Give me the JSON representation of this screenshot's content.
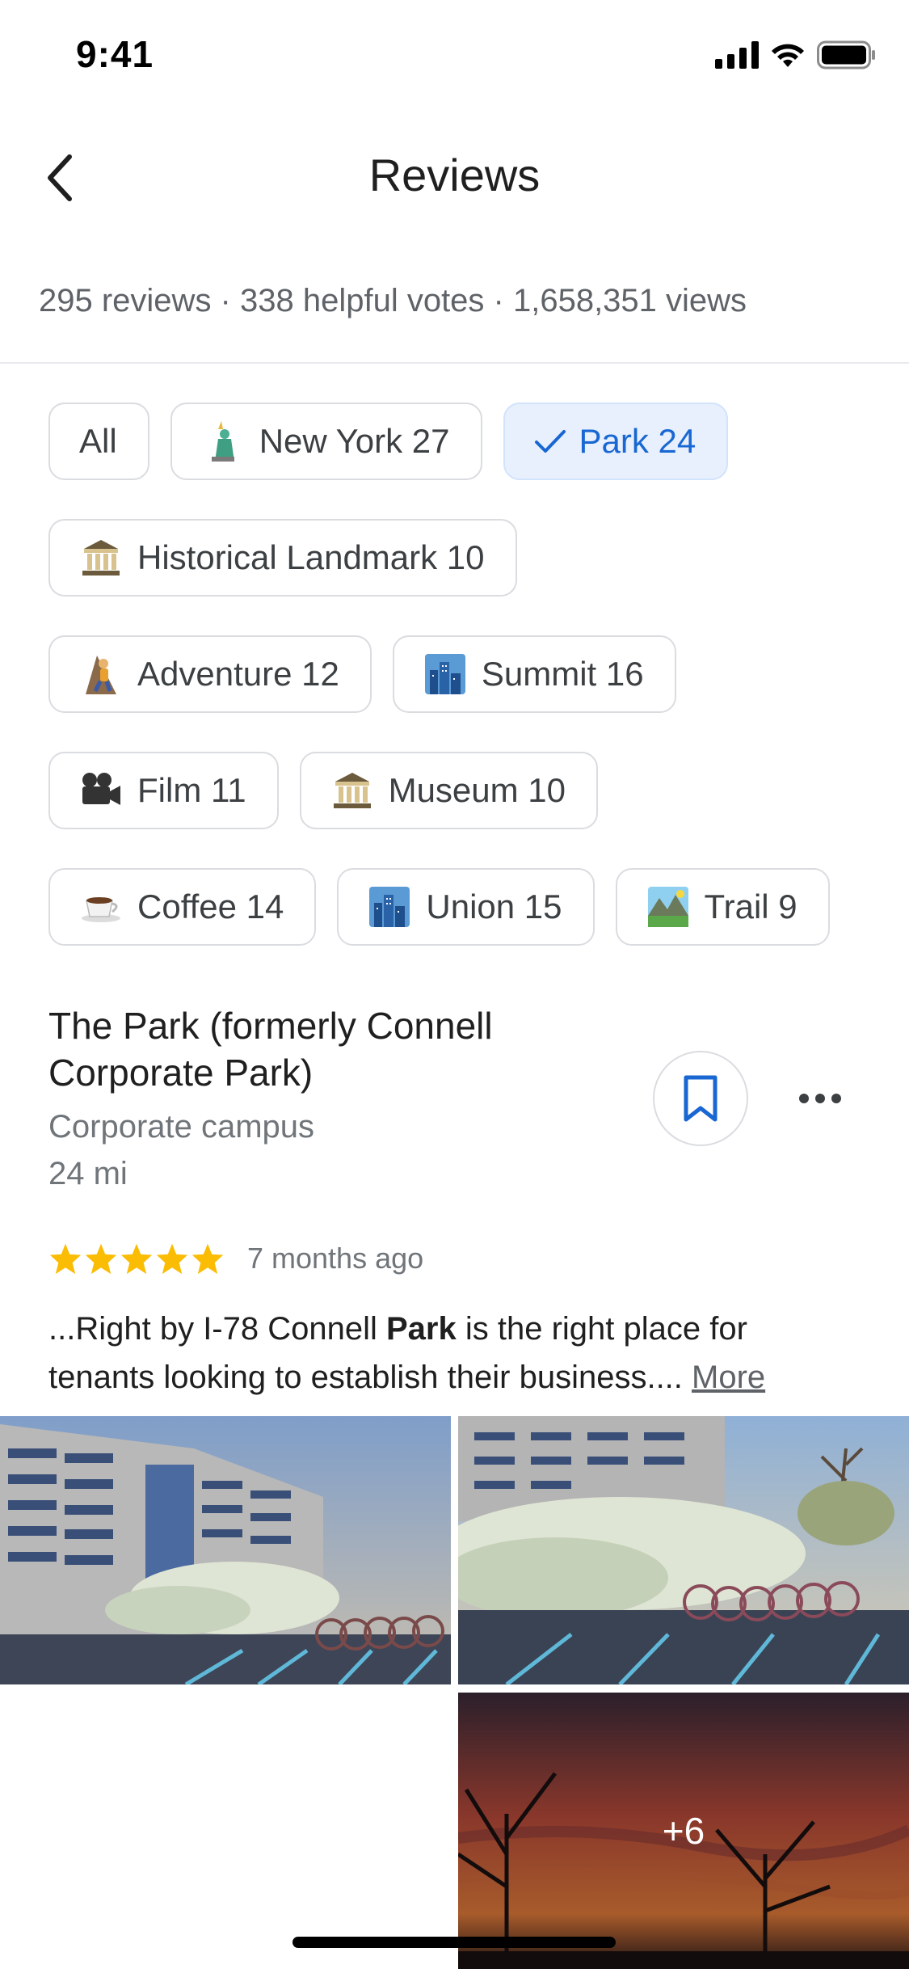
{
  "status_bar": {
    "time": "9:41"
  },
  "header": {
    "title": "Reviews"
  },
  "stats": {
    "text": "295 reviews · 338 helpful votes · 1,658,351 views"
  },
  "chips": [
    {
      "label": "All",
      "icon": ""
    },
    {
      "label": "New York 27",
      "icon": "statue-of-liberty-icon"
    },
    {
      "label": "Park 24",
      "icon": "check-icon",
      "selected": true
    },
    {
      "label": "Historical Landmark 10",
      "icon": "classical-building-icon"
    },
    {
      "label": "Adventure 12",
      "icon": "climber-icon"
    },
    {
      "label": "Summit 16",
      "icon": "cityscape-icon"
    },
    {
      "label": "Film 11",
      "icon": "movie-camera-icon"
    },
    {
      "label": "Museum 10",
      "icon": "classical-building-icon"
    },
    {
      "label": "Coffee 14",
      "icon": "coffee-icon"
    },
    {
      "label": "Union 15",
      "icon": "cityscape-icon"
    },
    {
      "label": "Trail 9",
      "icon": "national-park-icon"
    }
  ],
  "place": {
    "name": "The Park (formerly Connell Corporate Park)",
    "type": "Corporate campus",
    "distance": "24 mi"
  },
  "review": {
    "stars": 5,
    "date": "7 months ago",
    "text_before": "...Right by I-78 Connell ",
    "text_bold": "Park",
    "text_after": " is the right place for tenants looking to establish their business.... ",
    "more_label": "More"
  },
  "photos": {
    "more_count": "+6"
  },
  "colors": {
    "accent": "#1967d2",
    "selected_chip_bg": "#e8f0fe",
    "star": "#fbbc04"
  }
}
